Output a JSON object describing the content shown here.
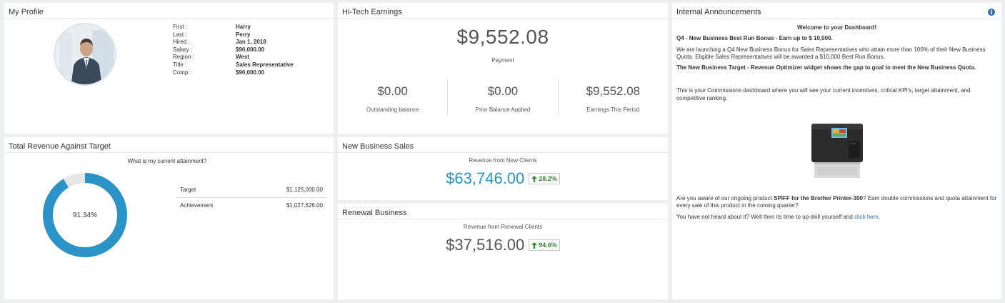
{
  "colors": {
    "accent_blue": "#2b93c5",
    "kpi_gray": "#555555",
    "positive_green": "#2f8a2f",
    "link": "#2a6eb5"
  },
  "profile": {
    "title": "My Profile",
    "rows": [
      {
        "k": "First :",
        "v": "Harry"
      },
      {
        "k": "Last :",
        "v": "Perry"
      },
      {
        "k": "Hired :",
        "v": "Jan 1, 2018"
      },
      {
        "k": "Salary :",
        "v": "$90,000.00"
      },
      {
        "k": "Region :",
        "v": "West"
      },
      {
        "k": "Title :",
        "v": "Sales Representative"
      },
      {
        "k": "Comp :",
        "v": "$90,000.00"
      }
    ]
  },
  "earnings": {
    "title": "Hi-Tech Earnings",
    "payment_amount": "$9,552.08",
    "payment_label": "Payment",
    "items": [
      {
        "amount": "$0.00",
        "label": "Outstanding balance"
      },
      {
        "amount": "$0.00",
        "label": "Prior Balance Applied"
      },
      {
        "amount": "$9,552.08",
        "label": "Earnings This Period"
      }
    ]
  },
  "announcements": {
    "title": "Internal Announcements",
    "info_icon": "info-icon",
    "welcome": "Welcome to your Dashboard!",
    "headline": "Q4 - New Business Best Run Bonus - Earn up to $ 10,000.",
    "para1": "We are launching a Q4 New Business Bonus for Sales Representatives who attain more than 100% of their New Business Quota. Eligible Sales Representatives will be awarded a $10,000 Best Run Bonus.",
    "para2": "The New Business Target - Revenue Optimizer widget shows the gap to goal to meet the New Business Quota.",
    "para3": "This is your Commissions dashboard where you will see your current incentives, critical KPI's, target attainment, and competitive ranking.",
    "spiff_pre": "Are you aware of our ongoing product ",
    "spiff_bold": "SPIFF for the Brother Printer-300",
    "spiff_post": "? Earn double commissions and quota attainment for every sale of this product in the coming quarter?",
    "upskill_pre": "You have not heard about it? Well then its time to up-skill yourself and ",
    "upskill_link": "click here",
    "upskill_post": "."
  },
  "revenue": {
    "title": "Total Revenue Against Target",
    "question": "What is my current attainment?",
    "attainment_label": "91.34%",
    "attainment_fraction": 0.9134,
    "rows": [
      {
        "label": "Target",
        "value": "$1,125,000.00"
      },
      {
        "label": "Achievement",
        "value": "$1,027,626.00"
      }
    ]
  },
  "new_business": {
    "title": "New Business Sales",
    "label": "Revenue from New Clients",
    "value": "$63,746.00",
    "change": "28.2%",
    "trend_icon": "arrow-up-icon"
  },
  "renewal": {
    "title": "Renewal Business",
    "label": "Revenue from Renewal Clients",
    "value": "$37,516.00",
    "change": "94.6%",
    "trend_icon": "arrow-up-icon"
  }
}
